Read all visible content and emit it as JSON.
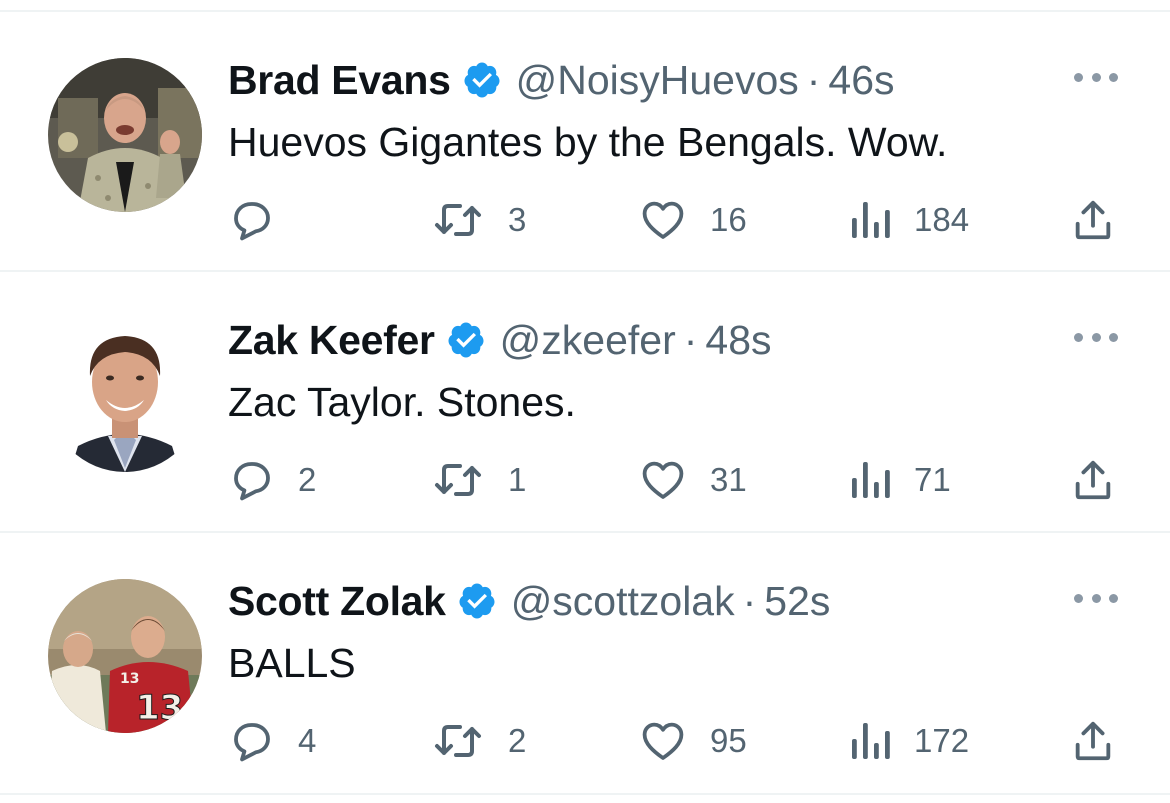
{
  "tweets": [
    {
      "name": "Brad Evans",
      "handle": "@NoisyHuevos",
      "separator": "·",
      "time": "46s",
      "text": "Huevos Gigantes by the Bengals. Wow.",
      "replies": "",
      "retweets": "3",
      "likes": "16",
      "views": "184"
    },
    {
      "name": "Zak Keefer",
      "handle": "@zkeefer",
      "separator": "·",
      "time": "48s",
      "text": "Zac Taylor. Stones.",
      "replies": "2",
      "retweets": "1",
      "likes": "31",
      "views": "71"
    },
    {
      "name": "Scott Zolak",
      "handle": "@scottzolak",
      "separator": "·",
      "time": "52s",
      "text": "BALLS",
      "replies": "4",
      "retweets": "2",
      "likes": "95",
      "views": "172"
    }
  ],
  "icons": {
    "verified": "verified-badge-icon",
    "more": "more-options-icon",
    "reply": "reply-icon",
    "retweet": "retweet-icon",
    "like": "heart-icon",
    "views": "views-icon",
    "share": "share-icon"
  },
  "colors": {
    "verified_blue": "#1d9bf0",
    "text_primary": "#0f1419",
    "text_secondary": "#536471",
    "icon_gray": "#536471",
    "divider": "#eff3f4"
  }
}
